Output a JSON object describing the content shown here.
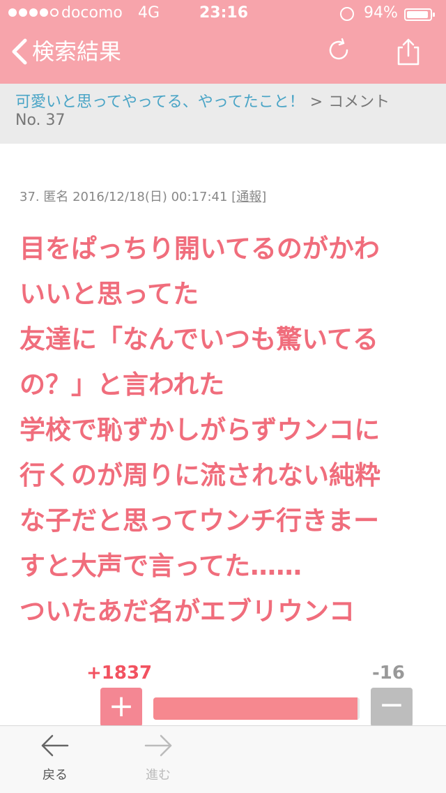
{
  "status_bar": {
    "carrier": "docomo",
    "network": "4G",
    "time": "23:16",
    "battery": "94%",
    "signal_bars": 4,
    "signal_total": 5
  },
  "nav": {
    "back_label": "検索結果",
    "icons": [
      "chevron-left-icon",
      "reload-icon",
      "share-icon"
    ]
  },
  "breadcrumb": {
    "link": "可愛いと思ってやってる、やってたこと！",
    "separator": ">",
    "current": "コメント",
    "number": "No. 37"
  },
  "comment": {
    "meta": "37. 匿名 2016/12/18(日) 00:17:41",
    "report_bracket_open": "[",
    "report_label": "通報",
    "report_bracket_close": "]",
    "lines": [
      "目をぱっちり開いてるのがかわ",
      "いいと思ってた",
      "友達に「なんでいつも驚いてる",
      "の？」と言われた",
      "学校で恥ずかしがらずウンコに",
      "行くのが周りに流されない純粋",
      "な子だと思ってウンチ行きまー",
      "すと大声で言ってた……",
      "ついたあだ名がエブリウンコ"
    ]
  },
  "votes": {
    "plus": "+1837",
    "minus": "-16",
    "plus_button": "+",
    "minus_button": "−",
    "plus_ratio": 0.9914
  },
  "toolbar": {
    "back_label": "戻る",
    "forward_label": "進む"
  },
  "colors": {
    "header_bg": "#f7a4ab",
    "comment_text": "#f06d7c",
    "plus_vote": "#f25260",
    "link": "#49a4c6"
  }
}
